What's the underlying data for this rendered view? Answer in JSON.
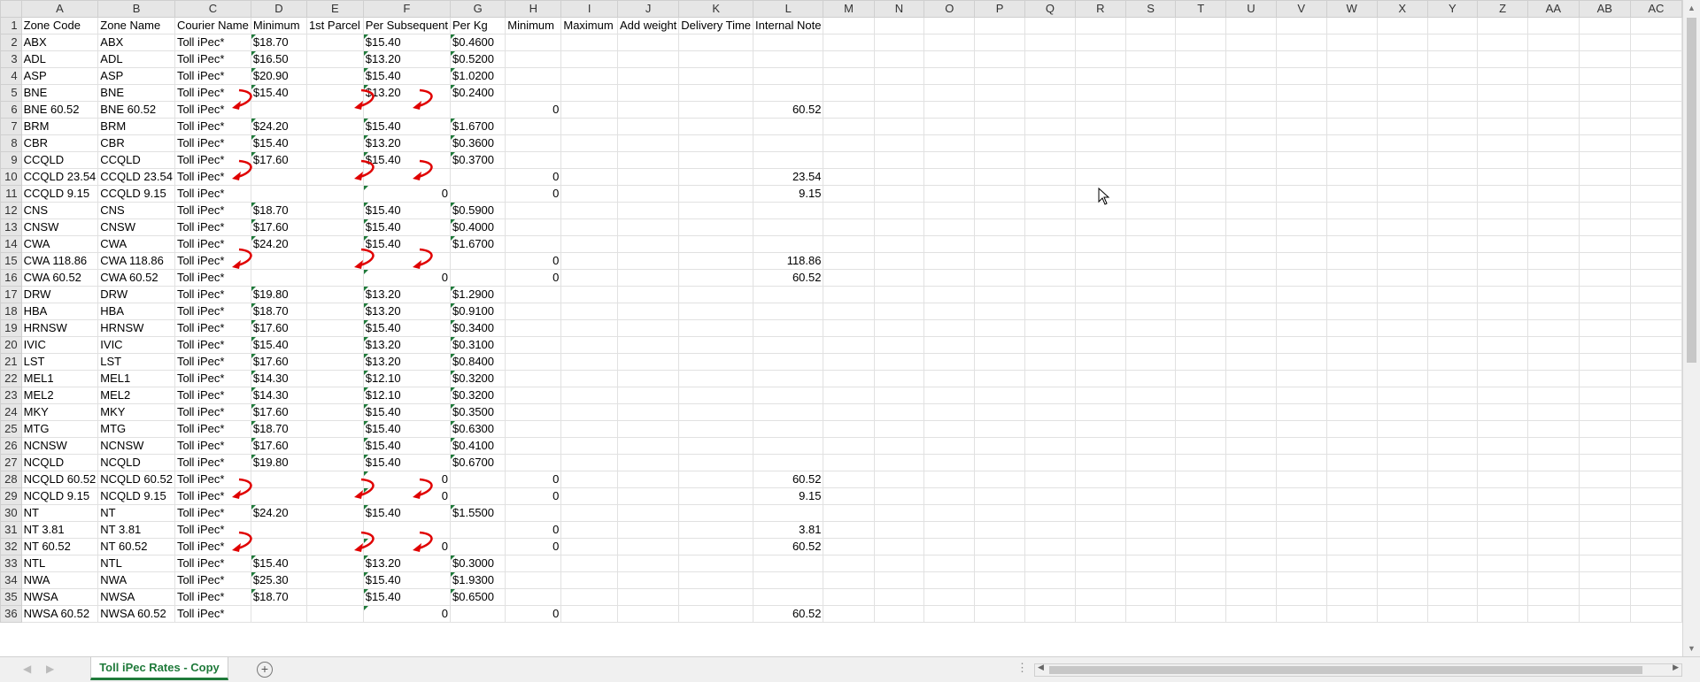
{
  "columns": [
    "A",
    "B",
    "C",
    "D",
    "E",
    "F",
    "G",
    "H",
    "I",
    "J",
    "K",
    "L",
    "M",
    "N",
    "O",
    "P",
    "Q",
    "R",
    "S",
    "T",
    "U",
    "V",
    "W",
    "X",
    "Y",
    "Z",
    "AA",
    "AB",
    "AC"
  ],
  "rows": [
    [
      "Zone Code",
      "Zone Name",
      "Courier Name",
      "Minimum",
      "1st Parcel",
      "Per Subsequent",
      "Per Kg",
      "Minimum",
      "Maximum",
      "Add weight",
      "Delivery Time",
      "Internal Note"
    ],
    [
      "ABX",
      "ABX",
      "Toll iPec*",
      "$18.70",
      "",
      "$15.40",
      "$0.4600",
      "",
      "",
      "",
      "",
      ""
    ],
    [
      "ADL",
      "ADL",
      "Toll iPec*",
      "$16.50",
      "",
      "$13.20",
      "$0.5200",
      "",
      "",
      "",
      "",
      ""
    ],
    [
      "ASP",
      "ASP",
      "Toll iPec*",
      "$20.90",
      "",
      "$15.40",
      "$1.0200",
      "",
      "",
      "",
      "",
      ""
    ],
    [
      "BNE",
      "BNE",
      "Toll iPec*",
      "$15.40",
      "",
      "$13.20",
      "$0.2400",
      "",
      "",
      "",
      "",
      ""
    ],
    [
      "BNE 60.52",
      "BNE 60.52",
      "Toll iPec*",
      "",
      "",
      "",
      "",
      "0",
      "",
      "",
      "",
      "60.52"
    ],
    [
      "BRM",
      "BRM",
      "Toll iPec*",
      "$24.20",
      "",
      "$15.40",
      "$1.6700",
      "",
      "",
      "",
      "",
      ""
    ],
    [
      "CBR",
      "CBR",
      "Toll iPec*",
      "$15.40",
      "",
      "$13.20",
      "$0.3600",
      "",
      "",
      "",
      "",
      ""
    ],
    [
      "CCQLD",
      "CCQLD",
      "Toll iPec*",
      "$17.60",
      "",
      "$15.40",
      "$0.3700",
      "",
      "",
      "",
      "",
      ""
    ],
    [
      "CCQLD 23.54",
      "CCQLD 23.54",
      "Toll iPec*",
      "",
      "",
      "",
      "",
      "0",
      "",
      "",
      "",
      "23.54"
    ],
    [
      "CCQLD 9.15",
      "CCQLD 9.15",
      "Toll iPec*",
      "",
      "",
      "0",
      "",
      "0",
      "",
      "",
      "",
      "9.15"
    ],
    [
      "CNS",
      "CNS",
      "Toll iPec*",
      "$18.70",
      "",
      "$15.40",
      "$0.5900",
      "",
      "",
      "",
      "",
      ""
    ],
    [
      "CNSW",
      "CNSW",
      "Toll iPec*",
      "$17.60",
      "",
      "$15.40",
      "$0.4000",
      "",
      "",
      "",
      "",
      ""
    ],
    [
      "CWA",
      "CWA",
      "Toll iPec*",
      "$24.20",
      "",
      "$15.40",
      "$1.6700",
      "",
      "",
      "",
      "",
      ""
    ],
    [
      "CWA 118.86",
      "CWA 118.86",
      "Toll iPec*",
      "",
      "",
      "",
      "",
      "0",
      "",
      "",
      "",
      "118.86"
    ],
    [
      "CWA 60.52",
      "CWA 60.52",
      "Toll iPec*",
      "",
      "",
      "0",
      "",
      "0",
      "",
      "",
      "",
      "60.52"
    ],
    [
      "DRW",
      "DRW",
      "Toll iPec*",
      "$19.80",
      "",
      "$13.20",
      "$1.2900",
      "",
      "",
      "",
      "",
      ""
    ],
    [
      "HBA",
      "HBA",
      "Toll iPec*",
      "$18.70",
      "",
      "$13.20",
      "$0.9100",
      "",
      "",
      "",
      "",
      ""
    ],
    [
      "HRNSW",
      "HRNSW",
      "Toll iPec*",
      "$17.60",
      "",
      "$15.40",
      "$0.3400",
      "",
      "",
      "",
      "",
      ""
    ],
    [
      "IVIC",
      "IVIC",
      "Toll iPec*",
      "$15.40",
      "",
      "$13.20",
      "$0.3100",
      "",
      "",
      "",
      "",
      ""
    ],
    [
      "LST",
      "LST",
      "Toll iPec*",
      "$17.60",
      "",
      "$13.20",
      "$0.8400",
      "",
      "",
      "",
      "",
      ""
    ],
    [
      "MEL1",
      "MEL1",
      "Toll iPec*",
      "$14.30",
      "",
      "$12.10",
      "$0.3200",
      "",
      "",
      "",
      "",
      ""
    ],
    [
      "MEL2",
      "MEL2",
      "Toll iPec*",
      "$14.30",
      "",
      "$12.10",
      "$0.3200",
      "",
      "",
      "",
      "",
      ""
    ],
    [
      "MKY",
      "MKY",
      "Toll iPec*",
      "$17.60",
      "",
      "$15.40",
      "$0.3500",
      "",
      "",
      "",
      "",
      ""
    ],
    [
      "MTG",
      "MTG",
      "Toll iPec*",
      "$18.70",
      "",
      "$15.40",
      "$0.6300",
      "",
      "",
      "",
      "",
      ""
    ],
    [
      "NCNSW",
      "NCNSW",
      "Toll iPec*",
      "$17.60",
      "",
      "$15.40",
      "$0.4100",
      "",
      "",
      "",
      "",
      ""
    ],
    [
      "NCQLD",
      "NCQLD",
      "Toll iPec*",
      "$19.80",
      "",
      "$15.40",
      "$0.6700",
      "",
      "",
      "",
      "",
      ""
    ],
    [
      "NCQLD 60.52",
      "NCQLD 60.52",
      "Toll iPec*",
      "",
      "",
      "0",
      "",
      "0",
      "",
      "",
      "",
      "60.52"
    ],
    [
      "NCQLD 9.15",
      "NCQLD 9.15",
      "Toll iPec*",
      "",
      "",
      "0",
      "",
      "0",
      "",
      "",
      "",
      "9.15"
    ],
    [
      "NT",
      "NT",
      "Toll iPec*",
      "$24.20",
      "",
      "$15.40",
      "$1.5500",
      "",
      "",
      "",
      "",
      ""
    ],
    [
      "NT 3.81",
      "NT 3.81",
      "Toll iPec*",
      "",
      "",
      "",
      "",
      "0",
      "",
      "",
      "",
      "3.81"
    ],
    [
      "NT 60.52",
      "NT 60.52",
      "Toll iPec*",
      "",
      "",
      "0",
      "",
      "0",
      "",
      "",
      "",
      "60.52"
    ],
    [
      "NTL",
      "NTL",
      "Toll iPec*",
      "$15.40",
      "",
      "$13.20",
      "$0.3000",
      "",
      "",
      "",
      "",
      ""
    ],
    [
      "NWA",
      "NWA",
      "Toll iPec*",
      "$25.30",
      "",
      "$15.40",
      "$1.9300",
      "",
      "",
      "",
      "",
      ""
    ],
    [
      "NWSA",
      "NWSA",
      "Toll iPec*",
      "$18.70",
      "",
      "$15.40",
      "$0.6500",
      "",
      "",
      "",
      "",
      ""
    ],
    [
      "NWSA 60.52",
      "NWSA 60.52",
      "Toll iPec*",
      "",
      "",
      "0",
      "",
      "0",
      "",
      "",
      "",
      "60.52"
    ]
  ],
  "sheet_tab": "Toll iPec Rates - Copy",
  "add_sheet_symbol": "+",
  "split_dots": "⋮",
  "icons": {
    "arrow_color": "#e00000",
    "indicator_color": "#1f7a3a",
    "cursor": "mouse-pointer-icon"
  }
}
